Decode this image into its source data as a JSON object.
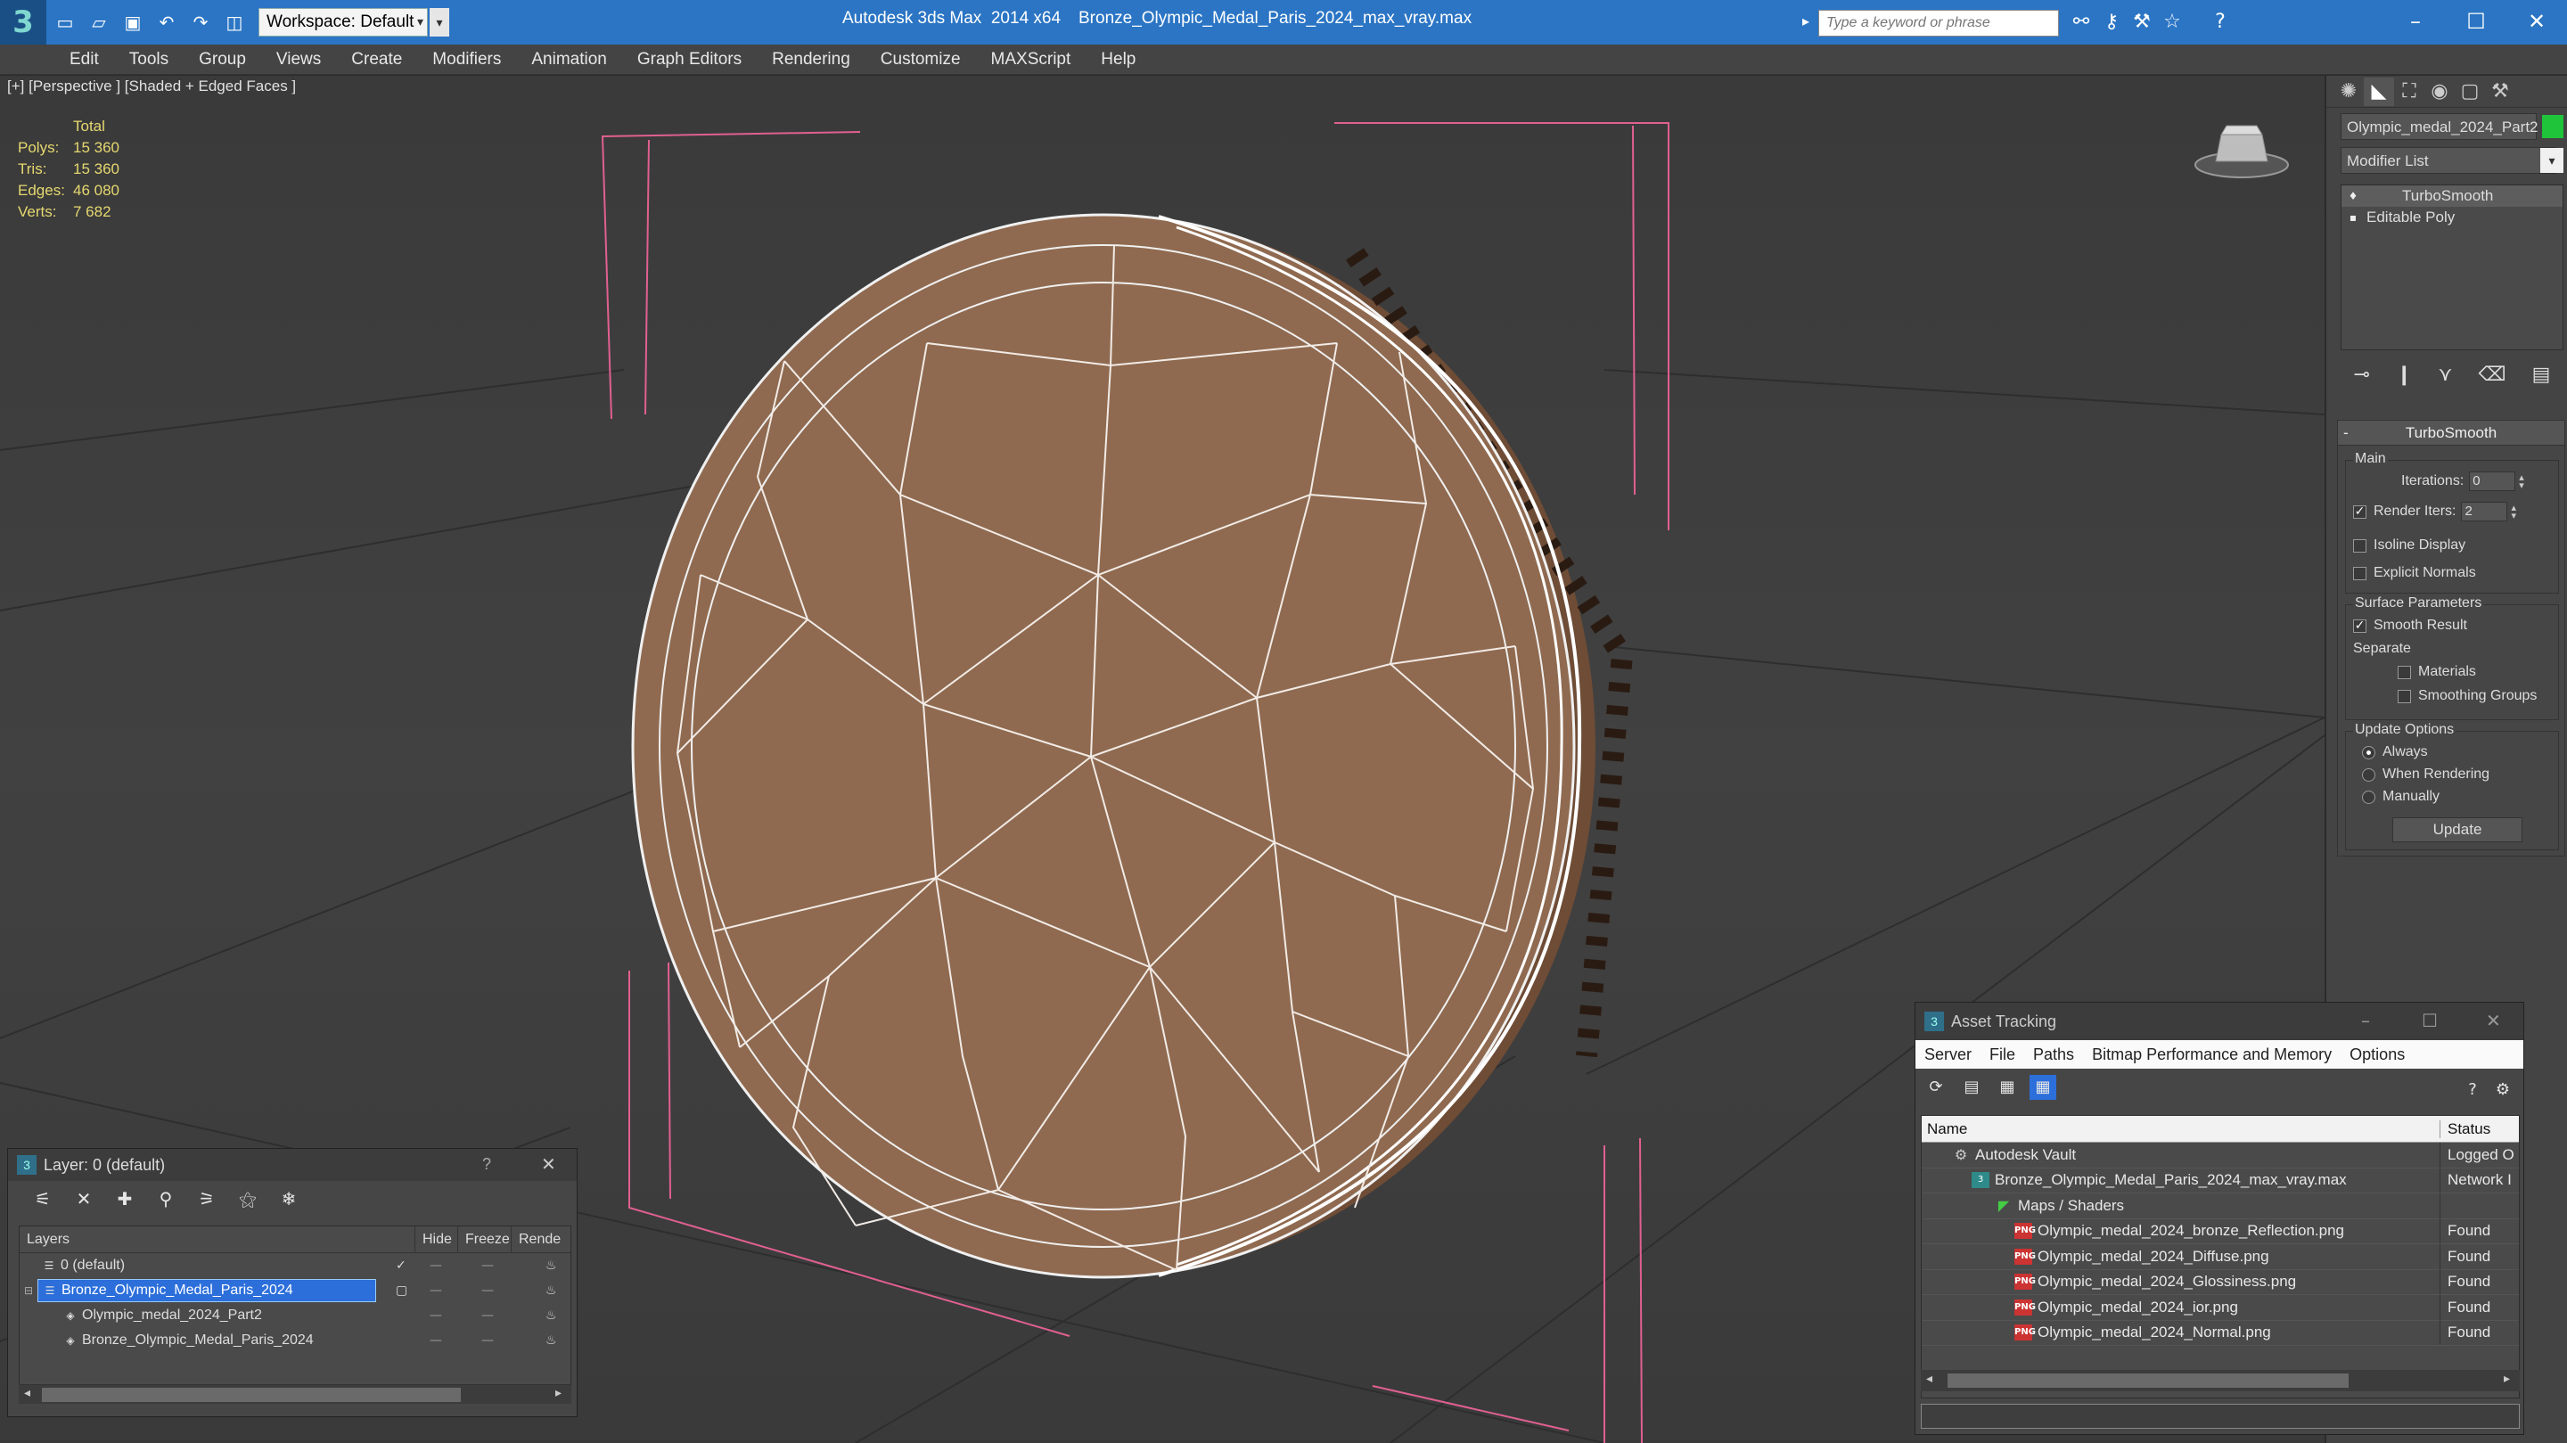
{
  "titlebar": {
    "app_title": "Autodesk 3ds Max  2014 x64",
    "file_title": "Bronze_Olympic_Medal_Paris_2024_max_vray.max",
    "workspace": "Workspace: Default",
    "search_placeholder": "Type a keyword or phrase",
    "icons": [
      "new-icon",
      "open-icon",
      "save-icon",
      "undo-icon",
      "redo-icon",
      "project-icon"
    ],
    "accent": "#2b75c4"
  },
  "menubar": {
    "items": [
      "Edit",
      "Tools",
      "Group",
      "Views",
      "Create",
      "Modifiers",
      "Animation",
      "Graph Editors",
      "Rendering",
      "Customize",
      "MAXScript",
      "Help"
    ]
  },
  "viewport": {
    "label": "[+] [Perspective ] [Shaded + Edged Faces ]",
    "stats": {
      "header": "Total",
      "polys_label": "Polys:",
      "polys": "15 360",
      "tris_label": "Tris:",
      "tris": "15 360",
      "edges_label": "Edges:",
      "edges": "46 080",
      "verts_label": "Verts:",
      "verts": "7 682"
    },
    "stats_color": "#e6d870",
    "model_color": "#8f6a50",
    "bracket_color": "#e06090"
  },
  "command_panel": {
    "object_name": "Olympic_medal_2024_Part2",
    "object_color": "#1fc43a",
    "modifier_list": "Modifier List",
    "stack": [
      {
        "label": "TurboSmooth",
        "selected": true
      },
      {
        "label": "Editable Poly",
        "selected": false
      }
    ],
    "rollout_title": "TurboSmooth",
    "main_label": "Main",
    "iterations_label": "Iterations:",
    "iterations": "0",
    "render_iters_label": "Render Iters:",
    "render_iters": "2",
    "isoline_label": "Isoline Display",
    "explicit_normals_label": "Explicit Normals",
    "surface_label": "Surface Parameters",
    "smooth_result_label": "Smooth Result",
    "separate_label": "Separate",
    "materials_label": "Materials",
    "smoothing_groups_label": "Smoothing Groups",
    "update_options_label": "Update Options",
    "always_label": "Always",
    "when_rendering_label": "When Rendering",
    "manually_label": "Manually",
    "update_button": "Update"
  },
  "layer_dialog": {
    "title": "Layer: 0 (default)",
    "help": "?",
    "columns": [
      "Layers",
      "Hide",
      "Freeze",
      "Rende"
    ],
    "rows": [
      {
        "name": "0 (default)",
        "selected": false,
        "indent": 0
      },
      {
        "name": "Bronze_Olympic_Medal_Paris_2024",
        "selected": true,
        "indent": 0
      },
      {
        "name": "Olympic_medal_2024_Part2",
        "selected": false,
        "indent": 1
      },
      {
        "name": "Bronze_Olympic_Medal_Paris_2024",
        "selected": false,
        "indent": 1
      }
    ]
  },
  "asset_dialog": {
    "title": "Asset Tracking",
    "menu": [
      "Server",
      "File",
      "Paths",
      "Bitmap Performance and Memory",
      "Options"
    ],
    "columns": [
      "Name",
      "Status"
    ],
    "rows": [
      {
        "name": "Autodesk Vault",
        "status": "Logged O",
        "icon": "vault",
        "indent": 1
      },
      {
        "name": "Bronze_Olympic_Medal_Paris_2024_max_vray.max",
        "status": "Network I",
        "icon": "max",
        "indent": 2
      },
      {
        "name": "Maps / Shaders",
        "status": "",
        "icon": "maps",
        "indent": 3
      },
      {
        "name": "Olympic_medal_2024_bronze_Reflection.png",
        "status": "Found",
        "icon": "png",
        "indent": 4
      },
      {
        "name": "Olympic_medal_2024_Diffuse.png",
        "status": "Found",
        "icon": "png",
        "indent": 4
      },
      {
        "name": "Olympic_medal_2024_Glossiness.png",
        "status": "Found",
        "icon": "png",
        "indent": 4
      },
      {
        "name": "Olympic_medal_2024_ior.png",
        "status": "Found",
        "icon": "png",
        "indent": 4
      },
      {
        "name": "Olympic_medal_2024_Normal.png",
        "status": "Found",
        "icon": "png",
        "indent": 4
      }
    ]
  }
}
